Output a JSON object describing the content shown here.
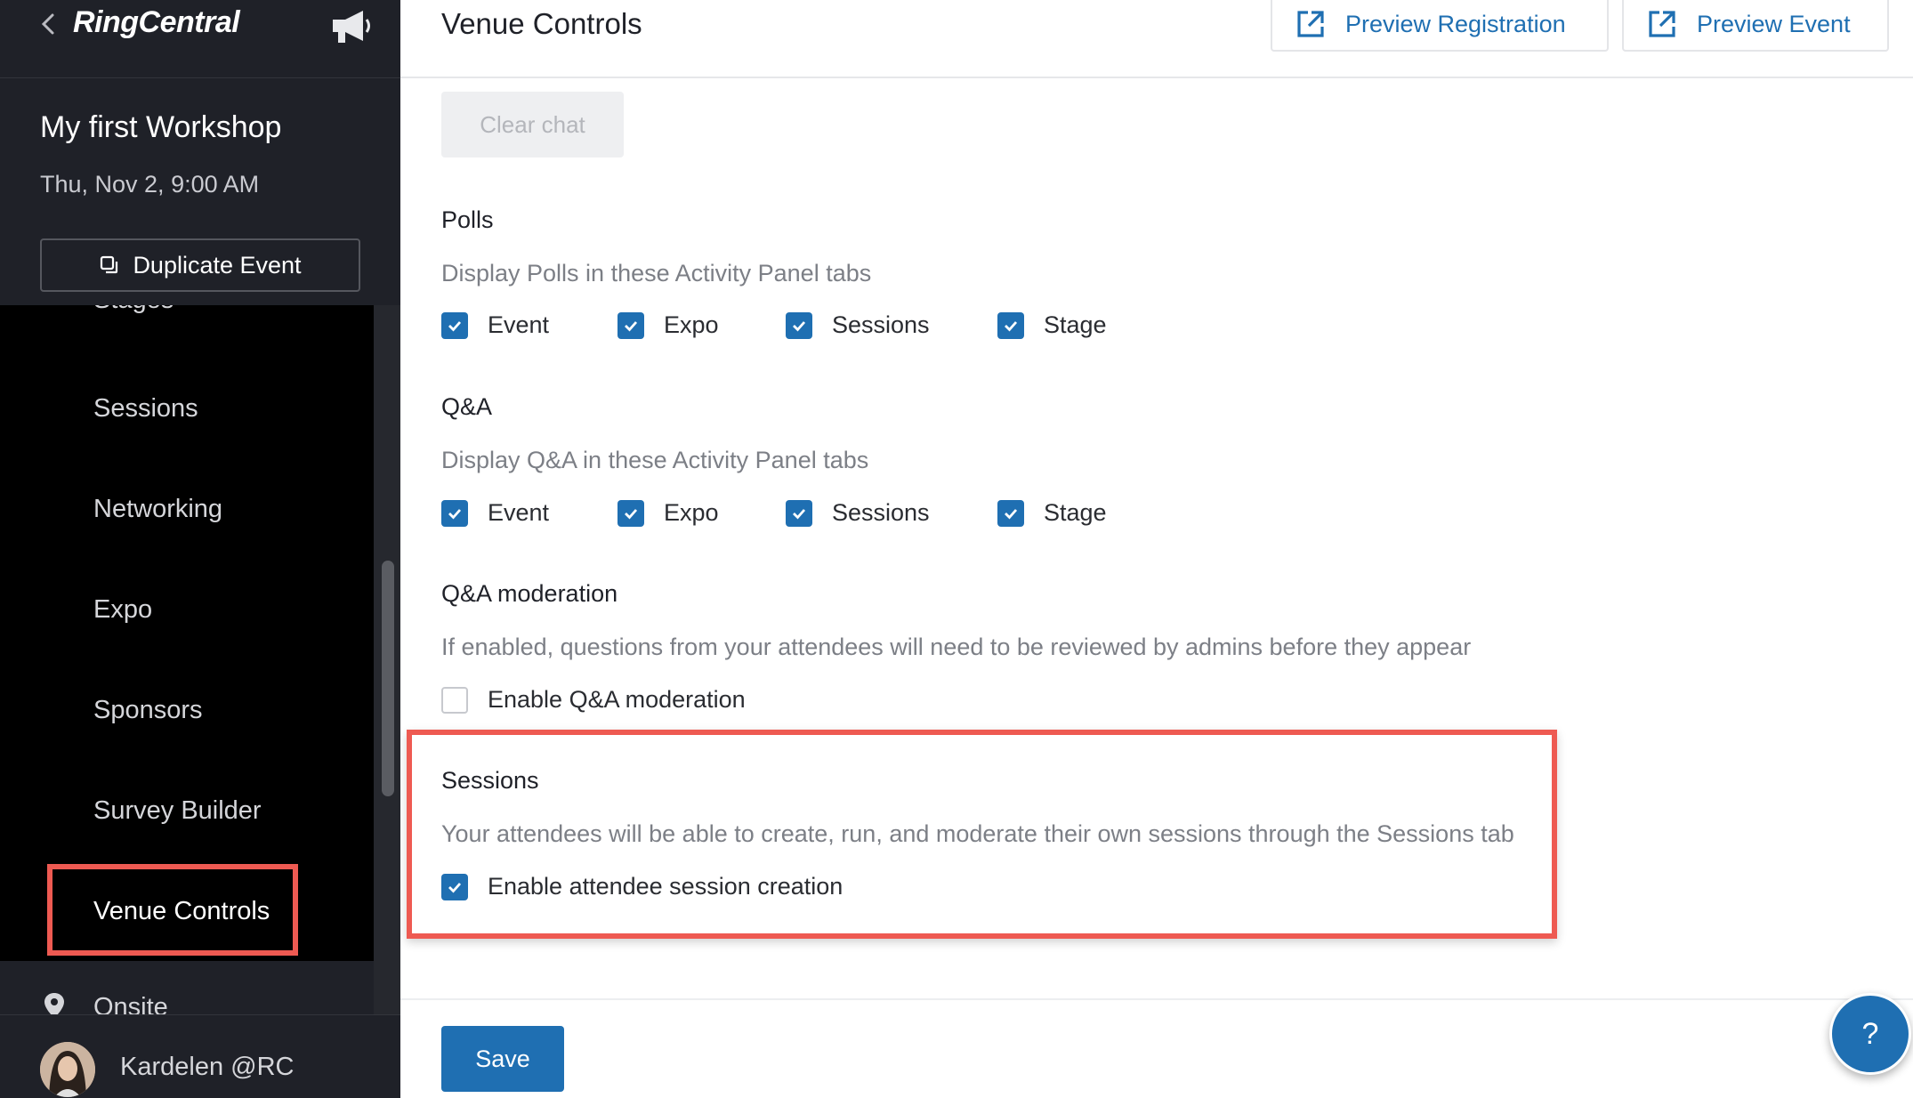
{
  "sidebar": {
    "logo": "RingCentral",
    "event_title": "My first Workshop",
    "event_date": "Thu, Nov 2, 9:00 AM",
    "duplicate_label": "Duplicate Event",
    "nav": [
      {
        "label": "Stages"
      },
      {
        "label": "Sessions"
      },
      {
        "label": "Networking"
      },
      {
        "label": "Expo"
      },
      {
        "label": "Sponsors"
      },
      {
        "label": "Survey Builder"
      },
      {
        "label": "Venue Controls",
        "active": true
      }
    ],
    "onsite_label": "Onsite",
    "user_name": "Kardelen @RC"
  },
  "header": {
    "title": "Venue Controls",
    "preview_registration": "Preview Registration",
    "preview_event": "Preview Event"
  },
  "content": {
    "clear_chat": "Clear chat",
    "polls": {
      "title": "Polls",
      "desc": "Display Polls in these Activity Panel tabs",
      "options": [
        {
          "label": "Event",
          "checked": true
        },
        {
          "label": "Expo",
          "checked": true
        },
        {
          "label": "Sessions",
          "checked": true
        },
        {
          "label": "Stage",
          "checked": true
        }
      ]
    },
    "qa": {
      "title": "Q&A",
      "desc": "Display Q&A in these Activity Panel tabs",
      "options": [
        {
          "label": "Event",
          "checked": true
        },
        {
          "label": "Expo",
          "checked": true
        },
        {
          "label": "Sessions",
          "checked": true
        },
        {
          "label": "Stage",
          "checked": true
        }
      ]
    },
    "qa_moderation": {
      "title": "Q&A moderation",
      "desc": "If enabled, questions from your attendees will need to be reviewed by admins before they appear",
      "option": {
        "label": "Enable Q&A moderation",
        "checked": false
      }
    },
    "sessions": {
      "title": "Sessions",
      "desc": "Your attendees will be able to create, run, and moderate their own sessions through the Sessions tab",
      "option": {
        "label": "Enable attendee session creation",
        "checked": true
      }
    },
    "save": "Save"
  },
  "help": "?",
  "colors": {
    "accent": "#1f6fb2",
    "highlight": "#ee5a52",
    "sidebar_bg": "#1f2128"
  }
}
